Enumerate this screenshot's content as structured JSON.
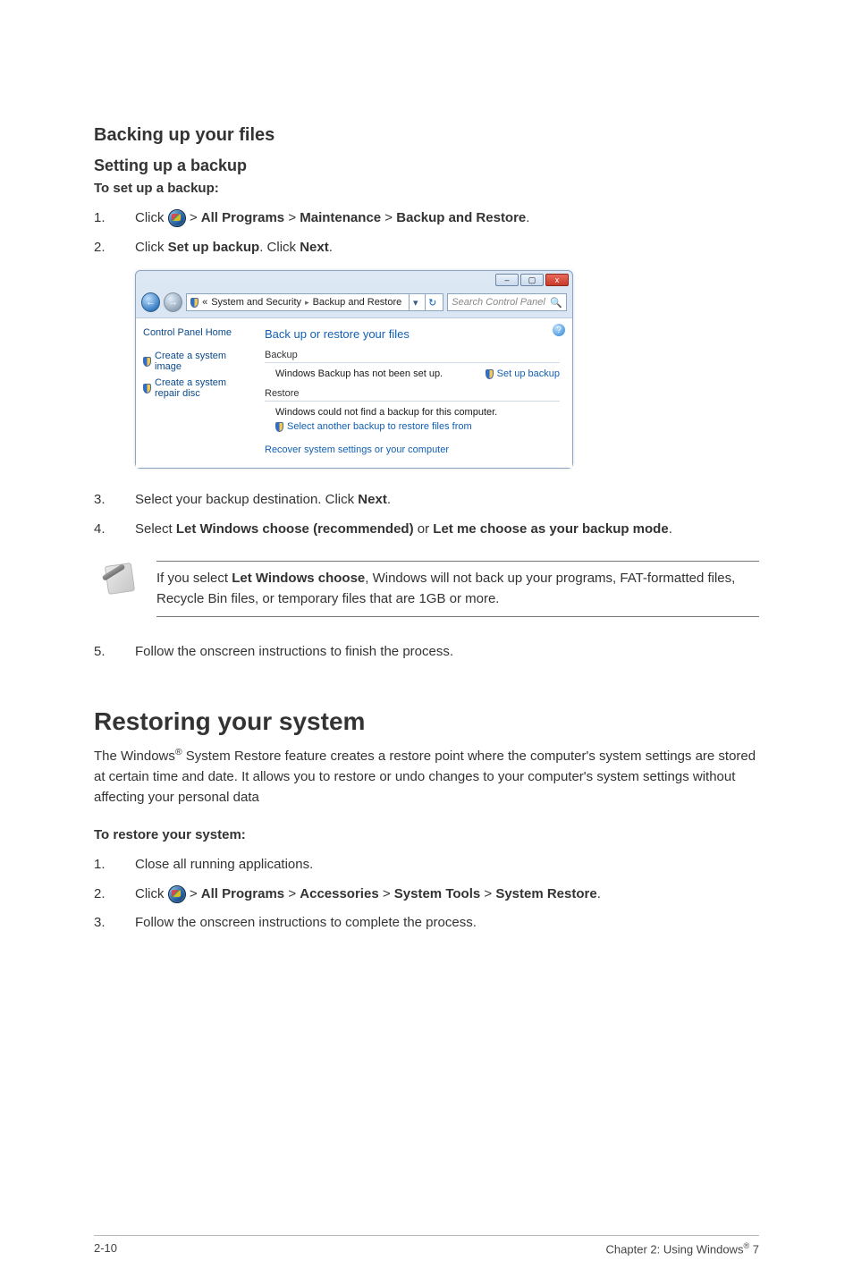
{
  "headings": {
    "h3": "Backing up your files",
    "h4": "Setting up a backup",
    "h5a": "To set up a backup:",
    "h2": "Restoring your system",
    "h5b": "To restore your system:"
  },
  "steps_a": {
    "s1_pre": "Click ",
    "s1_mid": " > ",
    "s1_allprograms": "All Programs",
    "s1_maintenance": "Maintenance",
    "s1_backup": "Backup and Restore",
    "s1_end": ".",
    "s2_pre": "Click ",
    "s2_set": "Set up backup",
    "s2_mid": ". Click ",
    "s2_next": "Next",
    "s2_end": ".",
    "s3_pre": "Select your backup destination. Click ",
    "s3_next": "Next",
    "s3_end": ".",
    "s4_pre": "Select ",
    "s4_opt1": "Let Windows choose (recommended)",
    "s4_or": " or ",
    "s4_opt2": "Let me choose as your backup mode",
    "s4_end": ".",
    "s5": "Follow the onscreen instructions to finish the process."
  },
  "note": {
    "pre": "If you select ",
    "bold": "Let Windows choose",
    "post": ", Windows will not back up your programs, FAT-formatted files, Recycle Bin files, or temporary files that are 1GB or more."
  },
  "restore_para": {
    "pre": "The Windows",
    "sup": "®",
    "post": " System Restore feature creates a restore point where the computer's system settings are stored at certain time and date. It allows you to restore or undo changes to your computer's system settings without affecting your personal data"
  },
  "steps_b": {
    "s1": "Close all running applications.",
    "s2_pre": "Click ",
    "s2_mid": " > ",
    "s2_allprograms": "All Programs",
    "s2_accessories": "Accessories",
    "s2_systools": "System Tools",
    "s2_sysrestore": "System Restore",
    "s2_end": ".",
    "s3": "Follow the onscreen instructions to complete the process."
  },
  "numbers": {
    "n1": "1.",
    "n2": "2.",
    "n3": "3.",
    "n4": "4.",
    "n5": "5."
  },
  "win": {
    "title_buttons": {
      "min": "–",
      "max": "▢",
      "close": "x"
    },
    "nav": {
      "back": "←",
      "fwd": "→"
    },
    "breadcrumb": {
      "bullet": "«",
      "c1": "System and Security",
      "c2": "Backup and Restore",
      "sep": "▸",
      "drop": "▾",
      "refresh": "↻"
    },
    "search_placeholder": "Search Control Panel",
    "search_icon": "🔍",
    "help": "?",
    "side": {
      "home": "Control Panel Home",
      "l1": "Create a system image",
      "l2": "Create a system repair disc"
    },
    "main": {
      "title": "Back up or restore your files",
      "grp_backup": "Backup",
      "backup_text": "Windows Backup has not been set up.",
      "setup_link": "Set up backup",
      "grp_restore": "Restore",
      "restore_text": "Windows could not find a backup for this computer.",
      "restore_link": "Select another backup to restore files from",
      "recover_link": "Recover system settings or your computer"
    }
  },
  "footer": {
    "left": "2-10",
    "right_pre": "Chapter 2: Using Windows",
    "right_sup": "®",
    "right_post": " 7"
  }
}
